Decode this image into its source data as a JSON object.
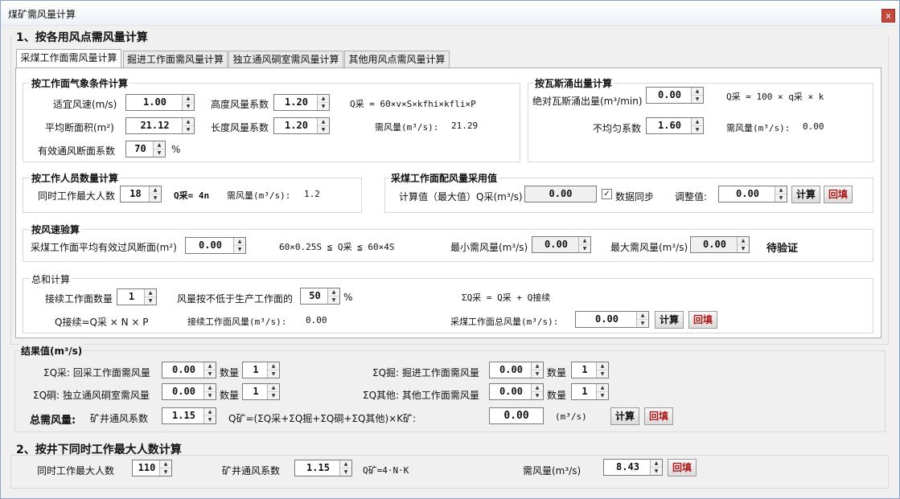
{
  "window": {
    "title": "煤矿需风量计算",
    "close": "x"
  },
  "section1": {
    "title": "1、按各用风点需风量计算",
    "tabs": [
      "采煤工作面需风量计算",
      "掘进工作面需风量计算",
      "独立通风硐室需风量计算",
      "其他用风点需风量计算"
    ],
    "weather": {
      "title": "按工作面气象条件计算",
      "speed_label": "适宜风速(m/s)",
      "speed": "1.00",
      "height_label": "高度风量系数",
      "height": "1.20",
      "formula": "Q采 = 60×v×S×kfhi×kfli×P",
      "area_label": "平均断面积(m²)",
      "area": "21.12",
      "length_label": "长度风量系数",
      "length": "1.20",
      "need_label": "需风量(m³/s):",
      "need": "21.29",
      "eff_label": "有效通风断面系数",
      "eff": "70",
      "eff_unit": "%"
    },
    "gas": {
      "title": "按瓦斯涌出量计算",
      "abs_label": "绝对瓦斯涌出量(m³/min)",
      "abs": "0.00",
      "formula": "Q采 = 100 × q采 × k",
      "uneven_label": "不均匀系数",
      "uneven": "1.60",
      "need_label": "需风量(m³/s):",
      "need": "0.00"
    },
    "people": {
      "title": "按工作人员数量计算",
      "max_label": "同时工作最大人数",
      "max": "18",
      "formula": "Q采= 4n",
      "need_label": "需风量(m³/s):",
      "need": "1.2"
    },
    "adopt": {
      "title": "采煤工作面配风量采用值",
      "calc_label": "计算值（最大值）Q采(m³/s)",
      "calc": "0.00",
      "sync_label": "数据同步",
      "sync_mark": "✓",
      "adjust_label": "调整值:",
      "adjust": "0.00",
      "calc_btn": "计算",
      "fill_btn": "回填"
    },
    "speed_check": {
      "title": "按风速验算",
      "avg_label": "采煤工作面平均有效过风断面(m²)",
      "avg": "0.00",
      "formula": "60×0.25S ≦ Q采 ≦ 60×4S",
      "min_label": "最小需风量(m³/s)",
      "min": "0.00",
      "max_label": "最大需风量(m³/s)",
      "max": "0.00",
      "status": "待验证"
    },
    "total": {
      "title": "总和计算",
      "count_label": "接续工作面数量",
      "count": "1",
      "pct_label": "风量按不低于生产工作面的",
      "pct": "50",
      "pct_unit": "%",
      "sum_formula": "ΣQ采 = Q采 + Q接续",
      "q_formula": "Q接续=Q采 × N × P",
      "cont_label": "接续工作面风量(m³/s):",
      "cont": "0.00",
      "all_label": "采煤工作面总风量(m³/s):",
      "all": "0.00",
      "calc_btn": "计算",
      "fill_btn": "回填"
    }
  },
  "results": {
    "title": "结果值(m³/s)",
    "rows": [
      {
        "label": "ΣQ采: 回采工作面需风量",
        "value": "0.00",
        "count_label": "数量",
        "count": "1"
      },
      {
        "label": "ΣQ掘: 掘进工作面需风量",
        "value": "0.00",
        "count_label": "数量",
        "count": "1"
      },
      {
        "label": "ΣQ硐: 独立通风硐室需风量",
        "value": "0.00",
        "count_label": "数量",
        "count": "1"
      },
      {
        "label": "ΣQ其他: 其他工作面需风量",
        "value": "0.00",
        "count_label": "数量",
        "count": "1"
      }
    ],
    "total_label": "总需风量:",
    "k_label": "矿井通风系数",
    "k": "1.15",
    "formula": "Q矿=(ΣQ采+ΣQ掘+ΣQ硐+ΣQ其他)×K矿:",
    "value": "0.00",
    "unit": "(m³/s)",
    "calc_btn": "计算",
    "fill_btn": "回填"
  },
  "section2": {
    "title": "2、按井下同时工作最大人数计算",
    "max_label": "同时工作最大人数",
    "max": "110",
    "k_label": "矿井通风系数",
    "k": "1.15",
    "formula": "Q矿=4·N·K",
    "need_label": "需风量(m³/s)",
    "need": "8.43",
    "fill_btn": "回填"
  }
}
